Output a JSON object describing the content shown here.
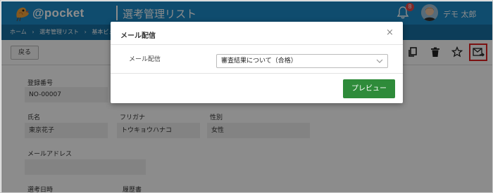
{
  "app": {
    "logo_text": "@pocket",
    "page_title": "選考管理リスト",
    "notification_count": "8",
    "user_name": "デモ 太郎"
  },
  "breadcrumb": [
    "ホーム",
    "選考管理リスト",
    "基本ビュ"
  ],
  "toolbar": {
    "back_label": "戻る",
    "icons": [
      "copy-icon",
      "trash-icon",
      "star-icon",
      "mail-send-icon"
    ],
    "highlight_color": "#e02020"
  },
  "form": {
    "reg_no_label": "登録番号",
    "reg_no_value": "NO-00007",
    "name_label": "氏名",
    "name_value": "東京花子",
    "furigana_label": "フリガナ",
    "furigana_value": "トウキョウハナコ",
    "gender_label": "性別",
    "gender_value": "女性",
    "email_label": "メールアドレス",
    "email_value": "",
    "date_label": "選考日時",
    "resume_label": "履歴書"
  },
  "modal": {
    "title": "メール配信",
    "field_label": "メール配信",
    "selected_template": "審査結果について（合格）",
    "preview_label": "プレビュー",
    "primary_color": "#2e8b3a"
  },
  "colors": {
    "header_bg": "#1d8bc9",
    "breadcrumb_bg": "#166fa2"
  }
}
